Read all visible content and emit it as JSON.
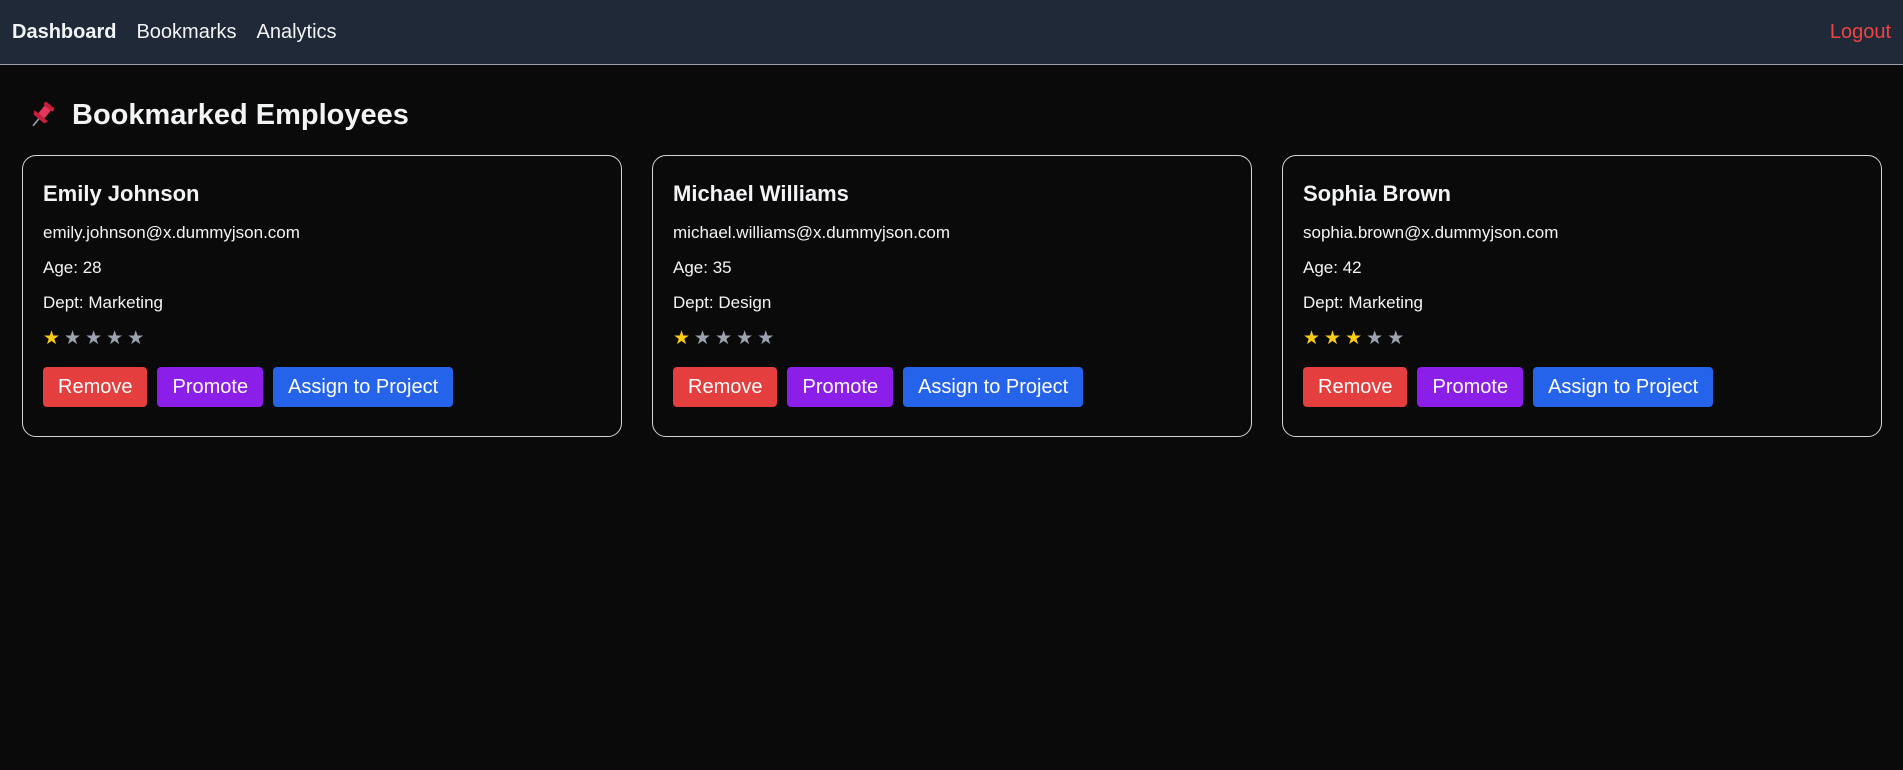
{
  "nav": {
    "links": [
      "Dashboard",
      "Bookmarks",
      "Analytics"
    ],
    "active": "Dashboard",
    "logout_label": "Logout"
  },
  "page": {
    "title_icon": "pushpin-icon",
    "title": "Bookmarked Employees"
  },
  "employees": [
    {
      "name": "Emily Johnson",
      "email": "emily.johnson@x.dummyjson.com",
      "age": "Age: 28",
      "dept": "Dept: Marketing",
      "rating": 1,
      "rating_max": 5
    },
    {
      "name": "Michael Williams",
      "email": "michael.williams@x.dummyjson.com",
      "age": "Age: 35",
      "dept": "Dept: Design",
      "rating": 1,
      "rating_max": 5
    },
    {
      "name": "Sophia Brown",
      "email": "sophia.brown@x.dummyjson.com",
      "age": "Age: 42",
      "dept": "Dept: Marketing",
      "rating": 3,
      "rating_max": 5
    }
  ],
  "actions": {
    "remove_label": "Remove",
    "promote_label": "Promote",
    "assign_label": "Assign to Project"
  },
  "colors": {
    "navbar_bg": "#1f2937",
    "page_bg": "#0a0a0a",
    "logout": "#ef4444",
    "star_filled": "#facc15",
    "star_empty": "#9ca3af",
    "remove_button": "#e53e3e",
    "promote_button": "#8b1ee8",
    "assign_button": "#2563eb"
  }
}
